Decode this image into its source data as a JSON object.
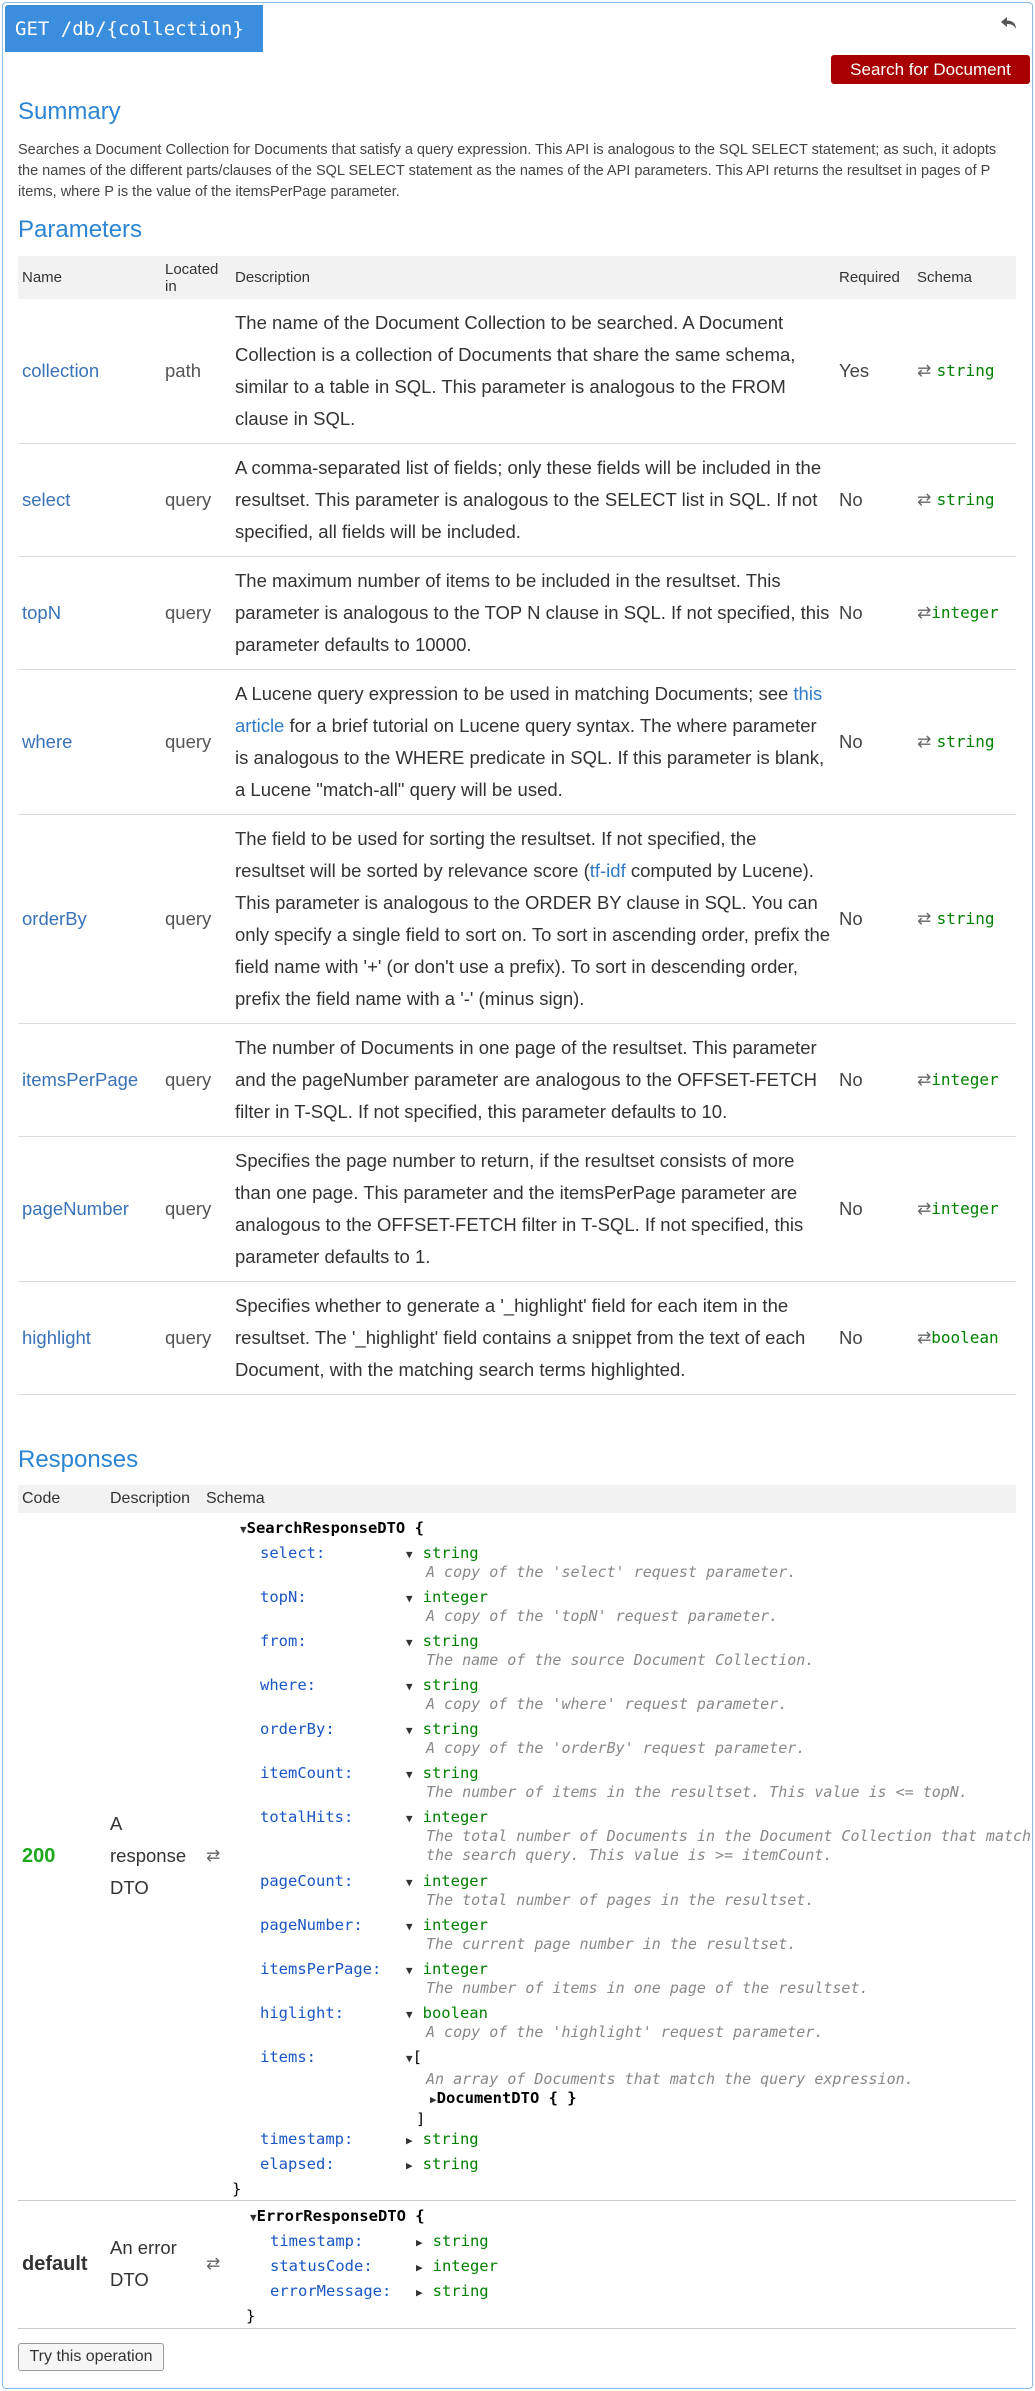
{
  "header": {
    "endpoint": "GET /db/{collection}",
    "action_button": "Search for Document"
  },
  "summary": {
    "title": "Summary",
    "text": "Searches a Document Collection for Documents that satisfy a query expression. This API is analogous to the SQL SELECT statement; as such, it adopts the names of the different parts/clauses of the SQL SELECT statement as the names of the API parameters. This API returns the resultset in pages of P items, where P is the value of the itemsPerPage parameter."
  },
  "parameters": {
    "title": "Parameters",
    "columns": [
      "Name",
      "Located in",
      "Description",
      "Required",
      "Schema"
    ],
    "rows": [
      {
        "name": "collection",
        "in": "path",
        "desc": "The name of the Document Collection to be searched. A Document Collection is a collection of Documents that share the same schema, similar to a table in SQL. This parameter is analogous to the FROM clause in SQL.",
        "required": "Yes",
        "schema": "string"
      },
      {
        "name": "select",
        "in": "query",
        "desc": "A comma-separated list of fields; only these fields will be included in the resultset. This parameter is analogous to the SELECT list in SQL. If not specified, all fields will be included.",
        "required": "No",
        "schema": "string"
      },
      {
        "name": "topN",
        "in": "query",
        "desc": "The maximum number of items to be included in the resultset. This parameter is analogous to the TOP N clause in SQL. If not specified, this parameter defaults to 10000.",
        "required": "No",
        "schema": "integer"
      },
      {
        "name": "where",
        "in": "query",
        "desc_pre": "A Lucene query expression to be used in matching Documents; see ",
        "desc_link": "this article",
        "desc_post": " for a brief tutorial on Lucene query syntax. The where parameter is analogous to the WHERE predicate in SQL. If this parameter is blank, a Lucene \"match-all\" query will be used.",
        "required": "No",
        "schema": "string"
      },
      {
        "name": "orderBy",
        "in": "query",
        "desc_pre": "The field to be used for sorting the resultset. If not specified, the resultset will be sorted by relevance score (",
        "desc_link": "tf-idf",
        "desc_post": " computed by Lucene). This parameter is analogous to the ORDER BY clause in SQL. You can only specify a single field to sort on. To sort in ascending order, prefix the field name with '+' (or don't use a prefix). To sort in descending order, prefix the field name with a '-' (minus sign).",
        "required": "No",
        "schema": "string"
      },
      {
        "name": "itemsPerPage",
        "in": "query",
        "desc": "The number of Documents in one page of the resultset. This parameter and the pageNumber parameter are analogous to the OFFSET-FETCH filter in T-SQL. If not specified, this parameter defaults to 10.",
        "required": "No",
        "schema": "integer"
      },
      {
        "name": "pageNumber",
        "in": "query",
        "desc": "Specifies the page number to return, if the resultset consists of more than one page. This parameter and the itemsPerPage parameter are analogous to the OFFSET-FETCH filter in T-SQL. If not specified, this parameter defaults to 1.",
        "required": "No",
        "schema": "integer"
      },
      {
        "name": "highlight",
        "in": "query",
        "desc": "Specifies whether to generate a '_highlight' field for each item in the resultset. The '_highlight' field contains a snippet from the text of each Document, with the matching search terms highlighted.",
        "required": "No",
        "schema": "boolean"
      }
    ]
  },
  "responses": {
    "title": "Responses",
    "columns": [
      "Code",
      "Description",
      "Schema"
    ],
    "ok": {
      "code": "200",
      "desc": "A response DTO",
      "model": "SearchResponseDTO {",
      "close": "}",
      "props": [
        {
          "name": "select:",
          "type": "string",
          "desc": "A copy of the 'select' request parameter."
        },
        {
          "name": "topN:",
          "type": "integer",
          "desc": "A copy of the 'topN' request parameter."
        },
        {
          "name": "from:",
          "type": "string",
          "desc": "The name of the source Document Collection."
        },
        {
          "name": "where:",
          "type": "string",
          "desc": "A copy of the 'where' request parameter."
        },
        {
          "name": "orderBy:",
          "type": "string",
          "desc": "A copy of the 'orderBy' request parameter."
        },
        {
          "name": "itemCount:",
          "type": "string",
          "desc": "The number of items in the resultset. This value is <= topN."
        },
        {
          "name": "totalHits:",
          "type": "integer",
          "desc": "The total number of Documents in the Document Collection that match the search query. This value is >= itemCount."
        },
        {
          "name": "pageCount:",
          "type": "integer",
          "desc": "The total number of pages in the resultset."
        },
        {
          "name": "pageNumber:",
          "type": "integer",
          "desc": "The current page number in the resultset."
        },
        {
          "name": "itemsPerPage:",
          "type": "integer",
          "desc": "The number of items in one page of the resultset."
        },
        {
          "name": "higlight:",
          "type": "boolean",
          "desc": "A copy of the 'highlight' request parameter."
        }
      ],
      "items": {
        "name": "items:",
        "open": "[",
        "desc": "An array of Documents that match the query expression.",
        "sub": "DocumentDTO { }",
        "close": "]"
      },
      "tail": [
        {
          "name": "timestamp:",
          "type": "string"
        },
        {
          "name": "elapsed:",
          "type": "string"
        }
      ]
    },
    "err": {
      "code": "default",
      "desc": "An error DTO",
      "model": "ErrorResponseDTO {",
      "close": "}",
      "props": [
        {
          "name": "timestamp:",
          "type": "string"
        },
        {
          "name": "statusCode:",
          "type": "integer"
        },
        {
          "name": "errorMessage:",
          "type": "string"
        }
      ]
    }
  },
  "footer": {
    "try_button": "Try this operation"
  },
  "icons": {
    "back": "back-arrow-icon",
    "swap": "swap-arrows-icon"
  },
  "colors": {
    "method": "#3b8dde",
    "danger_button": "#a80000",
    "heading": "#2c85d3",
    "ok_code": "#1ea81e",
    "type": "#008000"
  }
}
